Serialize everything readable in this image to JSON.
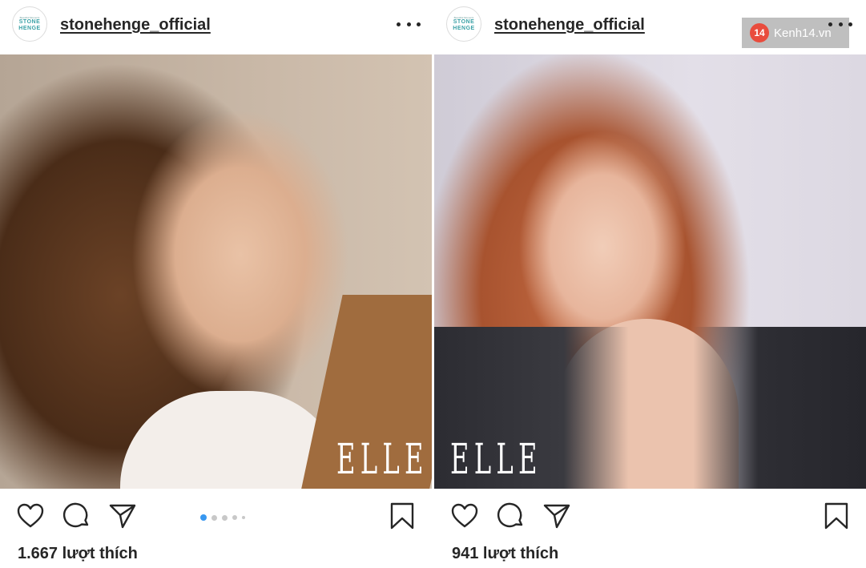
{
  "posts": [
    {
      "username": "stonehenge_official",
      "avatar": {
        "tagline": "Beautiful Moments",
        "logo_line1": "STONE",
        "logo_line2": "HENGE"
      },
      "photo_brand": "ELLE",
      "carousel": {
        "count": 5,
        "active_index": 0
      },
      "likes_text": "1.667 lượt thích",
      "icons": {
        "more": "more-horizontal-icon",
        "like": "heart-icon",
        "comment": "comment-bubble-icon",
        "share": "paper-plane-icon",
        "save": "bookmark-icon"
      }
    },
    {
      "username": "stonehenge_official",
      "avatar": {
        "tagline": "Beautiful Moments",
        "logo_line1": "STONE",
        "logo_line2": "HENGE"
      },
      "photo_brand": "ELLE",
      "likes_text": "941 lượt thích",
      "icons": {
        "more": "more-horizontal-icon",
        "like": "heart-icon",
        "comment": "comment-bubble-icon",
        "share": "paper-plane-icon",
        "save": "bookmark-icon"
      }
    }
  ],
  "watermark": {
    "badge": "14",
    "text": "Kenh14.vn"
  },
  "colors": {
    "text": "#262626",
    "carousel_active": "#3897f0",
    "carousel_inactive": "#c8c8c8",
    "watermark_badge": "#e94c3d"
  }
}
